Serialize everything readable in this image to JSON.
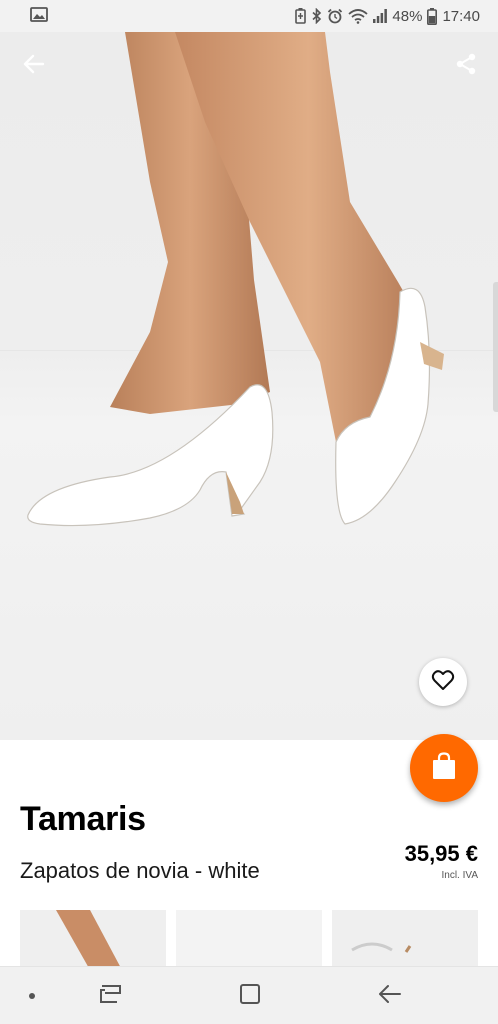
{
  "status_bar": {
    "battery_percent": "48%",
    "time": "17:40",
    "icons": [
      "image-notification-icon",
      "battery-saver-icon",
      "bluetooth-icon",
      "alarm-icon",
      "wifi-icon",
      "signal-icon",
      "battery-icon"
    ]
  },
  "header": {
    "back_icon": "back-arrow-icon",
    "share_icon": "share-icon"
  },
  "product": {
    "brand": "Tamaris",
    "name": "Zapatos de novia - white",
    "price": "35,95 €",
    "vat_note": "Incl. IVA"
  },
  "actions": {
    "wishlist_icon": "heart-icon",
    "cart_icon": "shopping-bag-icon"
  },
  "thumbnails": [
    "thumbnail-1",
    "thumbnail-2",
    "thumbnail-3"
  ],
  "navigation": {
    "items": [
      "dot-button",
      "recent-apps-button",
      "home-button",
      "back-button"
    ]
  },
  "colors": {
    "accent": "#ff6900",
    "status_bar_bg": "#f2f2f2",
    "nav_bar_bg": "#f1f1f1"
  }
}
